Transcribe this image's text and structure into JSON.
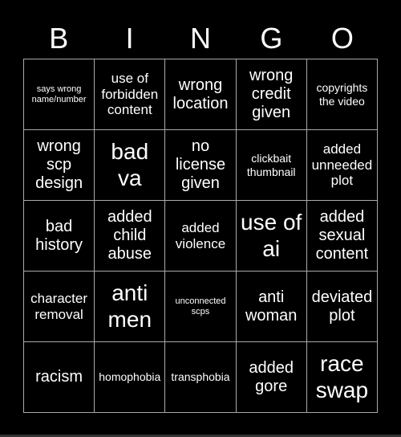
{
  "header": {
    "letters": [
      "B",
      "I",
      "N",
      "G",
      "O"
    ]
  },
  "cells": [
    {
      "text": "says wrong name/number",
      "size": 1
    },
    {
      "text": "use of forbidden content",
      "size": 3
    },
    {
      "text": "wrong location",
      "size": 4
    },
    {
      "text": "wrong credit given",
      "size": 4
    },
    {
      "text": "copyrights the video",
      "size": 2
    },
    {
      "text": "wrong scp design",
      "size": 4
    },
    {
      "text": "bad va",
      "size": 5
    },
    {
      "text": "no license given",
      "size": 4
    },
    {
      "text": "clickbait thumbnail",
      "size": 2
    },
    {
      "text": "added unneeded plot",
      "size": 3
    },
    {
      "text": "bad history",
      "size": 4
    },
    {
      "text": "added child abuse",
      "size": 4
    },
    {
      "text": "added violence",
      "size": 3
    },
    {
      "text": "use of ai",
      "size": 5
    },
    {
      "text": "added sexual content",
      "size": 4
    },
    {
      "text": "character removal",
      "size": 3
    },
    {
      "text": "anti men",
      "size": 5
    },
    {
      "text": "unconnected scps",
      "size": 1
    },
    {
      "text": "anti woman",
      "size": 4
    },
    {
      "text": "deviated plot",
      "size": 4
    },
    {
      "text": "racism",
      "size": 4
    },
    {
      "text": "homophobia",
      "size": 2
    },
    {
      "text": "transphobia",
      "size": 2
    },
    {
      "text": "added gore",
      "size": 4
    },
    {
      "text": "race swap",
      "size": 5
    }
  ]
}
